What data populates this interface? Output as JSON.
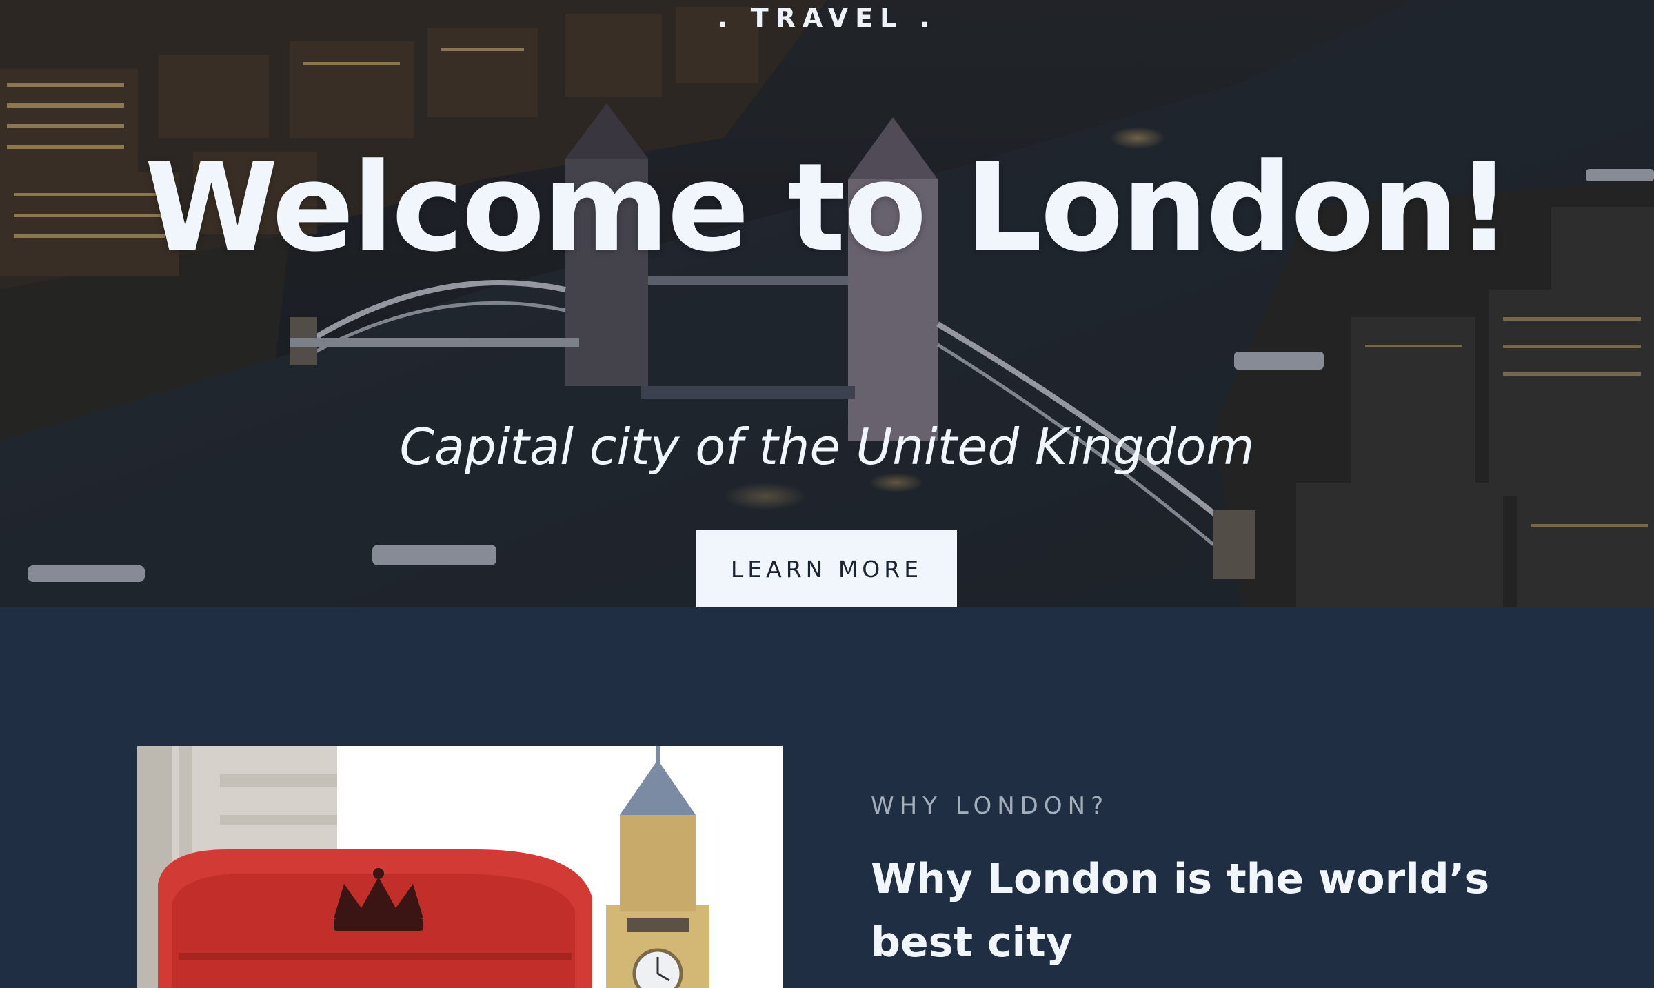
{
  "hero": {
    "eyebrow": ". TRAVEL .",
    "title": "Welcome to London!",
    "subtitle": "Capital city of the United Kingdom",
    "cta_label": "LEARN MORE"
  },
  "section": {
    "kicker": "WHY LONDON?",
    "heading": "Why London is the world’s best city"
  },
  "colors": {
    "hero_text": "#f1f6fc",
    "section_bg": "#1f2e43",
    "button_bg": "#f1f6fc",
    "kicker": "#a4adba",
    "phone_box_red": "#d23a36"
  }
}
